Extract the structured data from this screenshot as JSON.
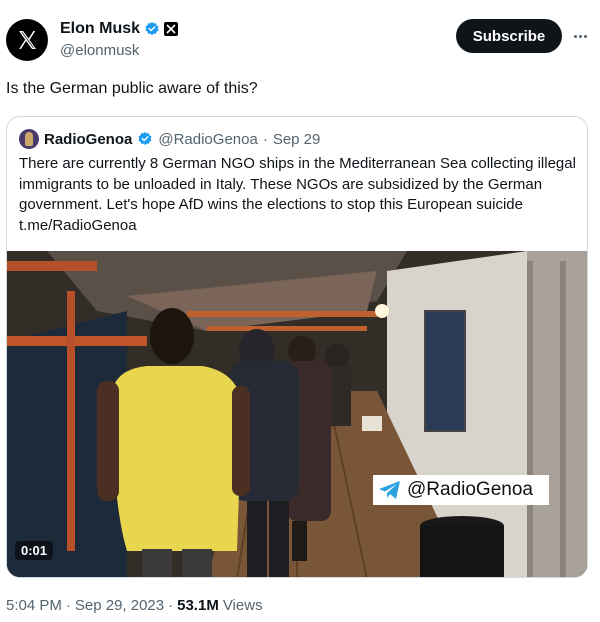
{
  "author": {
    "name": "Elon Musk",
    "handle": "@elonmusk",
    "avatar_icon": "x-logo-icon",
    "verified_color": "#1d9bf0"
  },
  "actions": {
    "subscribe_label": "Subscribe",
    "more_icon": "more-horizontal-icon"
  },
  "tweet": {
    "text": "Is the German public aware of this?"
  },
  "quote": {
    "name": "RadioGenoa",
    "handle": "@RadioGenoa",
    "separator": "·",
    "date": "Sep 29",
    "text": "There are currently 8 German NGO ships in the Mediterranean Sea collecting illegal immigrants to be unloaded in Italy. These NGOs are subsidized by the German government. Let's hope AfD wins the elections to stop this European suicide t.me/RadioGenoa",
    "video": {
      "watermark": "@RadioGenoa",
      "duration": "0:01"
    }
  },
  "footer": {
    "time": "5:04 PM",
    "sep1": "·",
    "date": "Sep 29, 2023",
    "sep2": "·",
    "views_count": "53.1M",
    "views_label": "Views"
  }
}
